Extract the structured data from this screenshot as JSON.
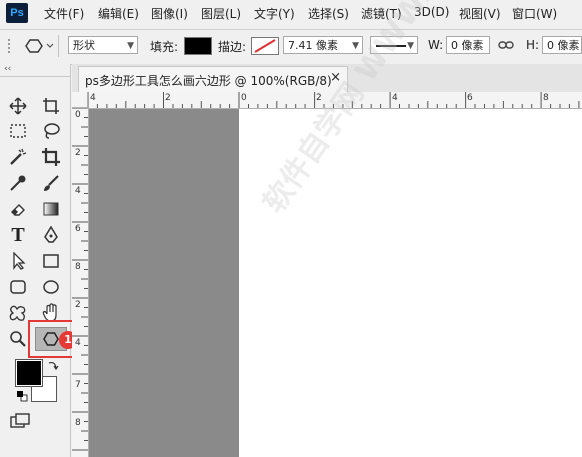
{
  "app": {
    "logo": "Ps"
  },
  "menu": [
    "文件(F)",
    "编辑(E)",
    "图像(I)",
    "图层(L)",
    "文字(Y)",
    "选择(S)",
    "滤镜(T)",
    "3D(D)",
    "视图(V)",
    "窗口(W)"
  ],
  "options": {
    "mode_value": "形状",
    "fill_label": "填充:",
    "stroke_label": "描边:",
    "stroke_width": "7.41 像素",
    "w_label": "W:",
    "w_value": "0 像素",
    "h_label": "H:",
    "h_value": "0 像素",
    "fill_color": "#000000"
  },
  "document": {
    "tab_title": "ps多边形工具怎么画六边形 @ 100%(RGB/8)",
    "close": "×"
  },
  "rulers": {
    "h_labels": [
      "4",
      "2",
      "0",
      "2",
      "4",
      "6",
      "8"
    ],
    "v_labels": [
      "0",
      "2",
      "4",
      "6",
      "8",
      "2",
      "4",
      "6",
      "7",
      "8",
      "1"
    ]
  },
  "toolbar": {
    "collapse": "‹‹",
    "badge": "1",
    "highlight_color": "#e53935",
    "foreground_color": "#000000",
    "background_color": "#ffffff"
  },
  "watermark": "软件自学网 WWW.RJZXW.COM"
}
